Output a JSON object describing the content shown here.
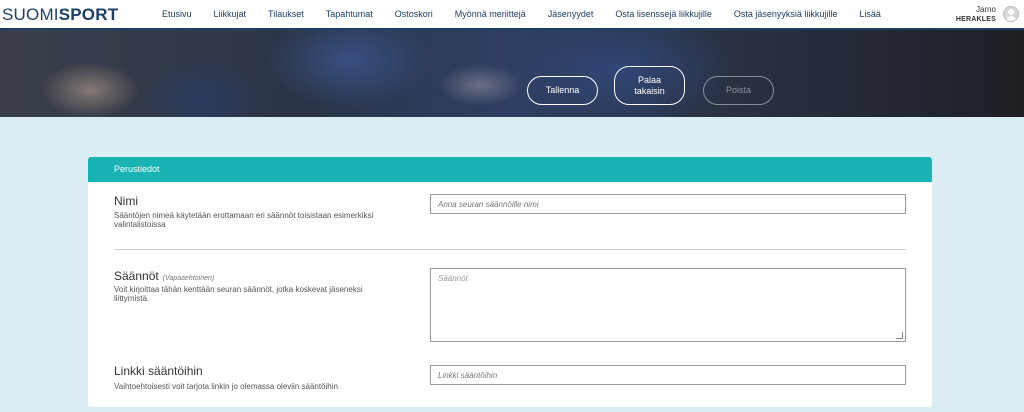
{
  "brand": {
    "light": "SUOMI",
    "bold": "SPORT"
  },
  "nav": {
    "items": [
      "Etusivu",
      "Liikkujat",
      "Tilaukset",
      "Tapahtumat",
      "Ostoskori",
      "Myönnä meriittejä",
      "Jäsenyydet",
      "Osta lisenssejä liikkujille",
      "Osta jäsenyyksiä liikkujille",
      "Lisää"
    ]
  },
  "user": {
    "name": "Jarno",
    "org": "HERAKLES"
  },
  "hero_actions": {
    "save": "Tallenna",
    "back": "Palaa takaisin",
    "delete": "Poista"
  },
  "form": {
    "section_title": "Perustiedot",
    "name": {
      "label": "Nimi",
      "description": "Sääntöjen nimeä käytetään erottamaan eri säännöt toisistaan esimerkiksi valintalistoissa",
      "placeholder": "Anna seuran säännöille nimi"
    },
    "rules": {
      "label": "Säännöt",
      "optional": "(Vapaaehtoinen)",
      "description": "Voit kirjoittaa tähän kenttään seuran säännöt, jotka koskevat jäseneksi liittymistä.",
      "placeholder": "Säännöt"
    },
    "link": {
      "label": "Linkki sääntöihin",
      "description": "Vaihtoehtoisesti voit tarjota linkin jo olemassa oleviin sääntöihin",
      "placeholder": "Linkki sääntöihin"
    }
  },
  "colors": {
    "navy": "#1c3f66",
    "teal": "#1ab3b3",
    "page_bg": "#d9edf3"
  }
}
